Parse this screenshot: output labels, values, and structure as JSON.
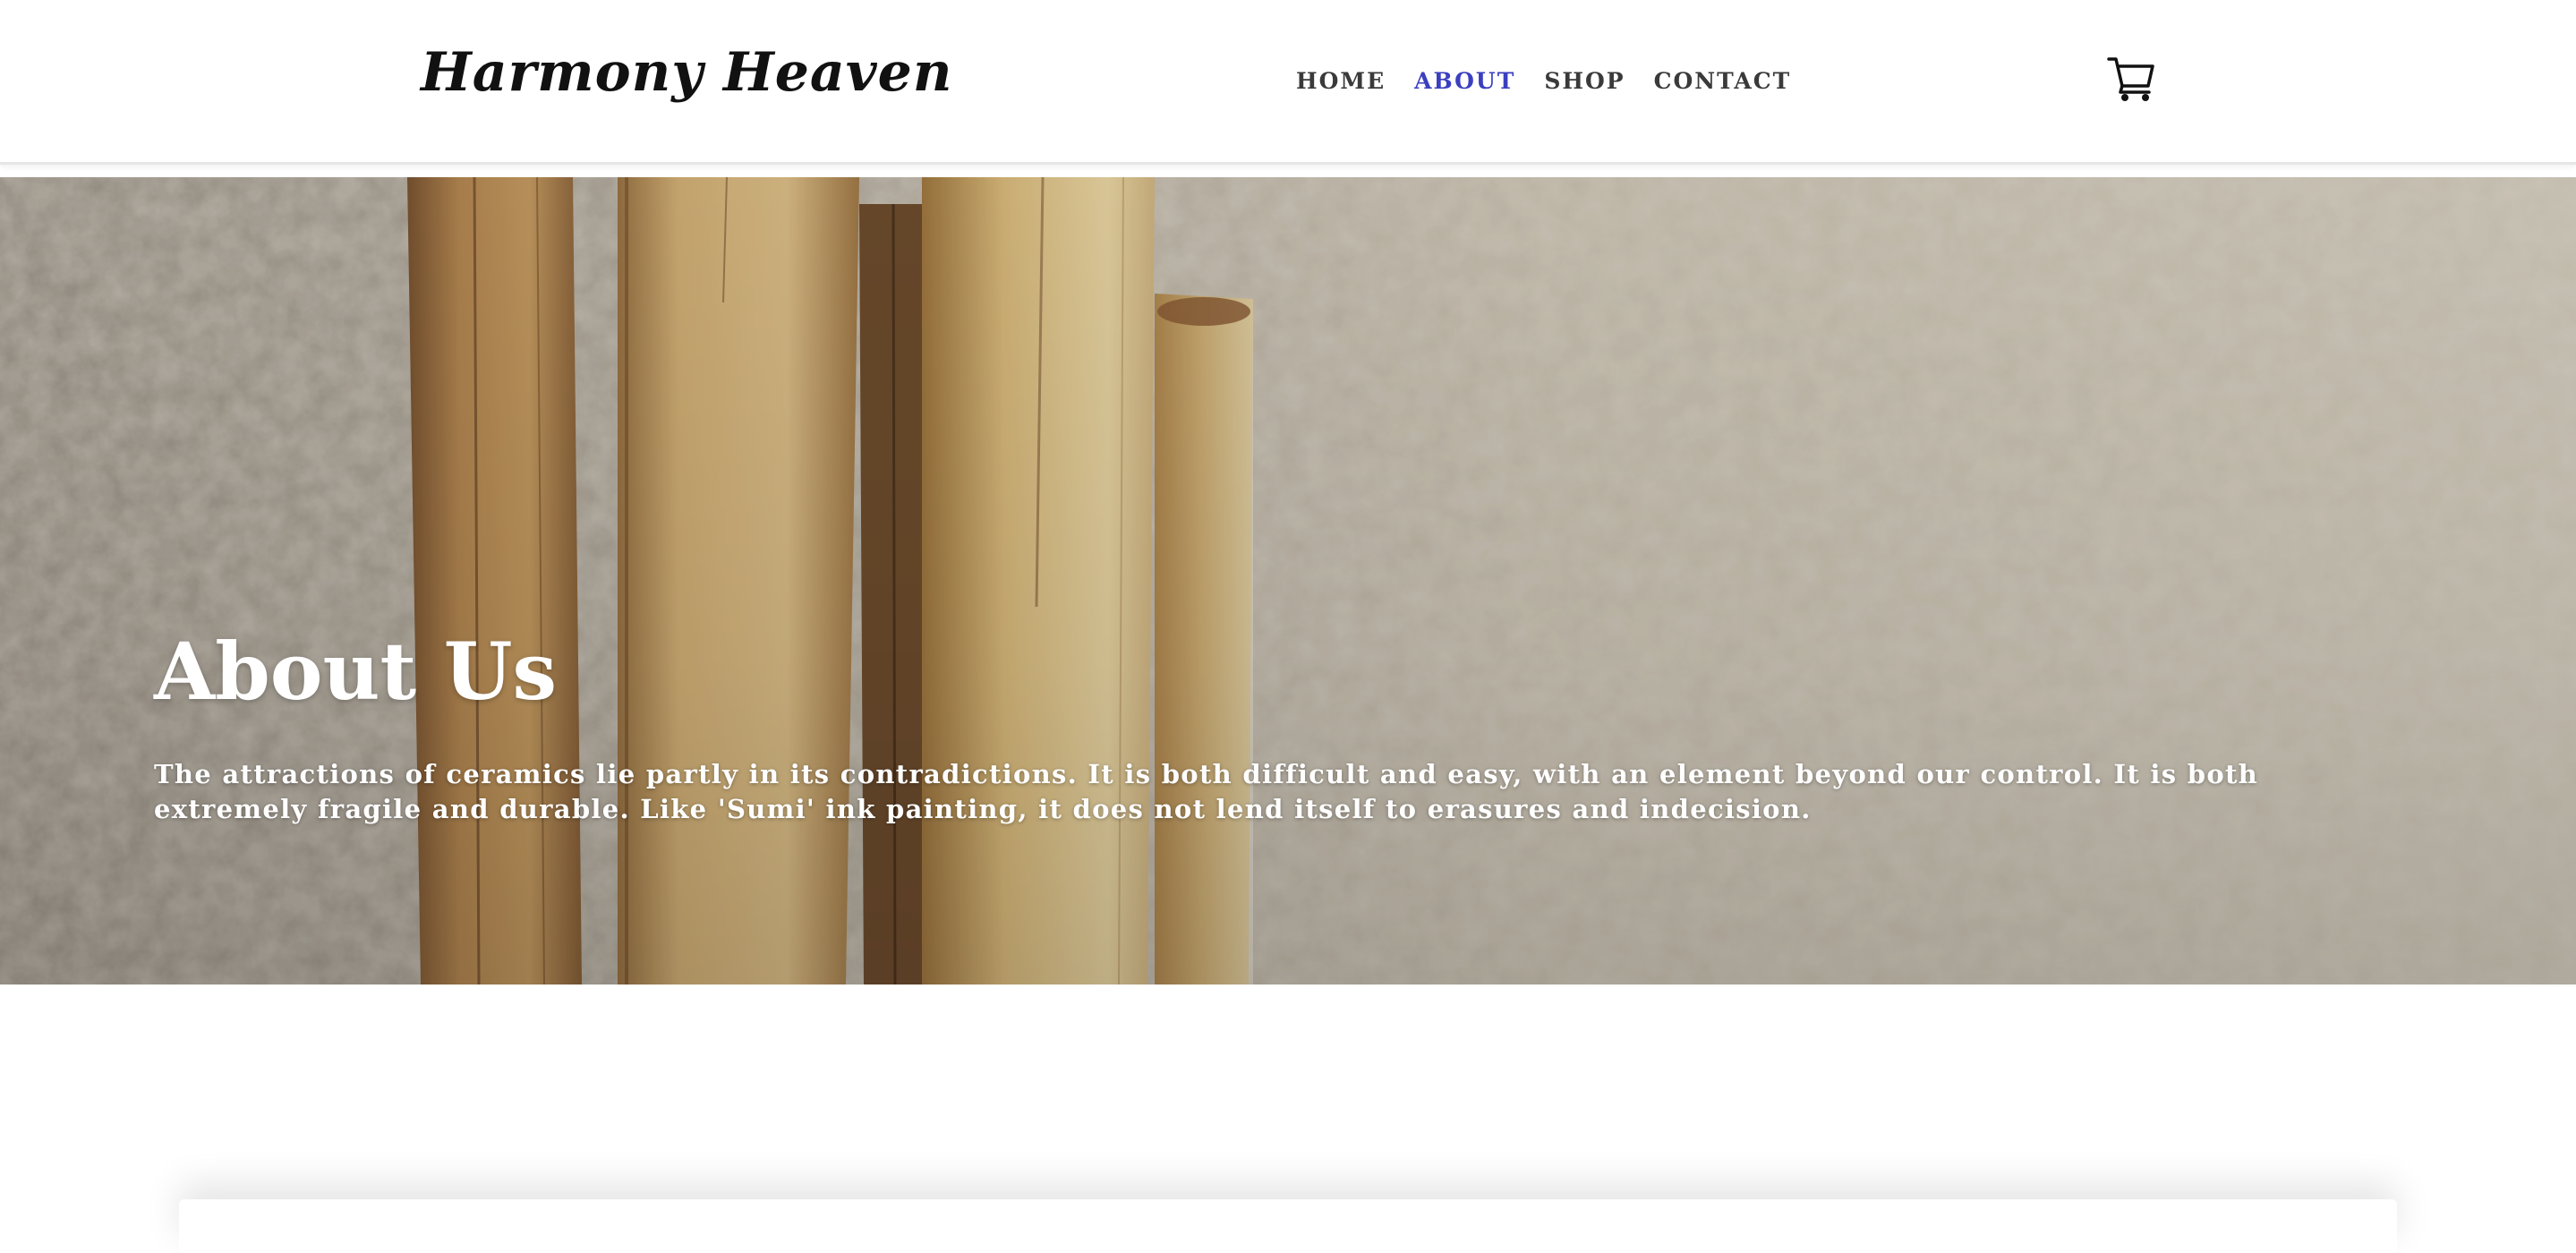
{
  "brand": {
    "name": "Harmony Heaven"
  },
  "nav": {
    "items": [
      {
        "label": "HOME"
      },
      {
        "label": "ABOUT"
      },
      {
        "label": "SHOP"
      },
      {
        "label": "CONTACT"
      }
    ],
    "active": "ABOUT"
  },
  "cart": {
    "icon": "cart-icon"
  },
  "hero": {
    "title": "About Us",
    "text": "The attractions of ceramics lie partly in its contradictions. It is both difficult and easy, with an element beyond our control. It is both extremely fragile and durable. Like 'Sumi' ink painting, it does not lend itself to erasures and indecision."
  },
  "colors": {
    "accent": "#3b3fbf",
    "nav_text": "#3a3a3a",
    "brand_text": "#111111",
    "hero_text": "#ffffff"
  }
}
